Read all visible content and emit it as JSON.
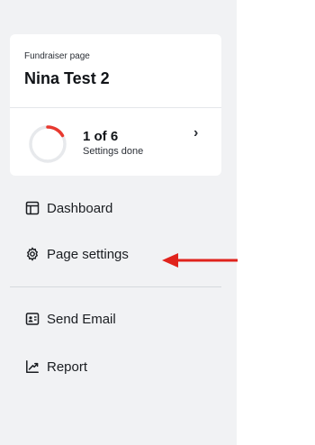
{
  "card": {
    "subtitle": "Fundraiser page",
    "title": "Nina Test 2"
  },
  "progress": {
    "count_label": "1 of 6",
    "caption": "Settings done",
    "done": 1,
    "total": 6
  },
  "nav": {
    "dashboard": "Dashboard",
    "page_settings": "Page settings",
    "send_email": "Send Email",
    "report": "Report"
  },
  "colors": {
    "progress_accent": "#e8392f",
    "annotation_arrow": "#e0231c"
  },
  "icons": {
    "dashboard": "layout-icon",
    "page_settings": "gear-icon",
    "send_email": "contact-card-icon",
    "report": "chart-up-icon",
    "progress_chevron": "chevron-right-icon"
  }
}
